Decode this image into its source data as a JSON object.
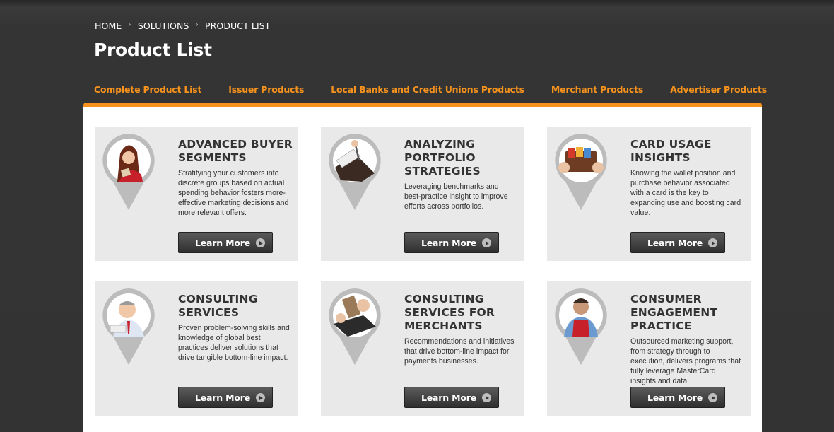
{
  "breadcrumb": {
    "items": [
      "HOME",
      "SOLUTIONS",
      "PRODUCT LIST"
    ],
    "separator": "›"
  },
  "page_title": "Product List",
  "tabs": [
    {
      "label": "Complete Product List"
    },
    {
      "label": "Issuer Products"
    },
    {
      "label": "Local Banks and Credit Unions Products"
    },
    {
      "label": "Merchant Products"
    },
    {
      "label": "Advertiser Products"
    }
  ],
  "colors": {
    "accent": "#f7931d",
    "background": "#333333",
    "card": "#e9e9e9",
    "button": "#3a3a3a",
    "pin": "#bcbcbc"
  },
  "products": [
    {
      "title": "ADVANCED BUYER SEGMENTS",
      "description": "Stratifying your customers into discrete groups based on actual spending behavior fosters more-effective marketing decisions and more relevant offers.",
      "button_label": "Learn More",
      "icon": "woman-shopper-illustration-icon"
    },
    {
      "title": "ANALYZING PORTFOLIO STRATEGIES",
      "description": "Leveraging benchmarks and best-practice insight to improve efforts across portfolios.",
      "button_label": "Learn More",
      "icon": "pen-document-illustration-icon"
    },
    {
      "title": "CARD USAGE INSIGHTS",
      "description": "Knowing the wallet position and purchase behavior associated with a card is the key to expanding use and boosting card value.",
      "button_label": "Learn More",
      "icon": "wallet-illustration-icon"
    },
    {
      "title": "CONSULTING SERVICES",
      "description": "Proven problem-solving skills and knowledge of global best practices deliver solutions that drive tangible bottom-line impact.",
      "button_label": "Learn More",
      "icon": "consultant-illustration-icon"
    },
    {
      "title": "CONSULTING SERVICES FOR MERCHANTS",
      "description": "Recommendations and initiatives that drive bottom-line impact for payments businesses.",
      "button_label": "Learn More",
      "icon": "card-terminal-illustration-icon"
    },
    {
      "title": "CONSUMER ENGAGEMENT PRACTICE",
      "description": "Outsourced marketing support, from strategy through to execution, delivers programs that fully leverage MasterCard insights and data.",
      "button_label": "Learn More",
      "icon": "merchant-illustration-icon"
    }
  ]
}
